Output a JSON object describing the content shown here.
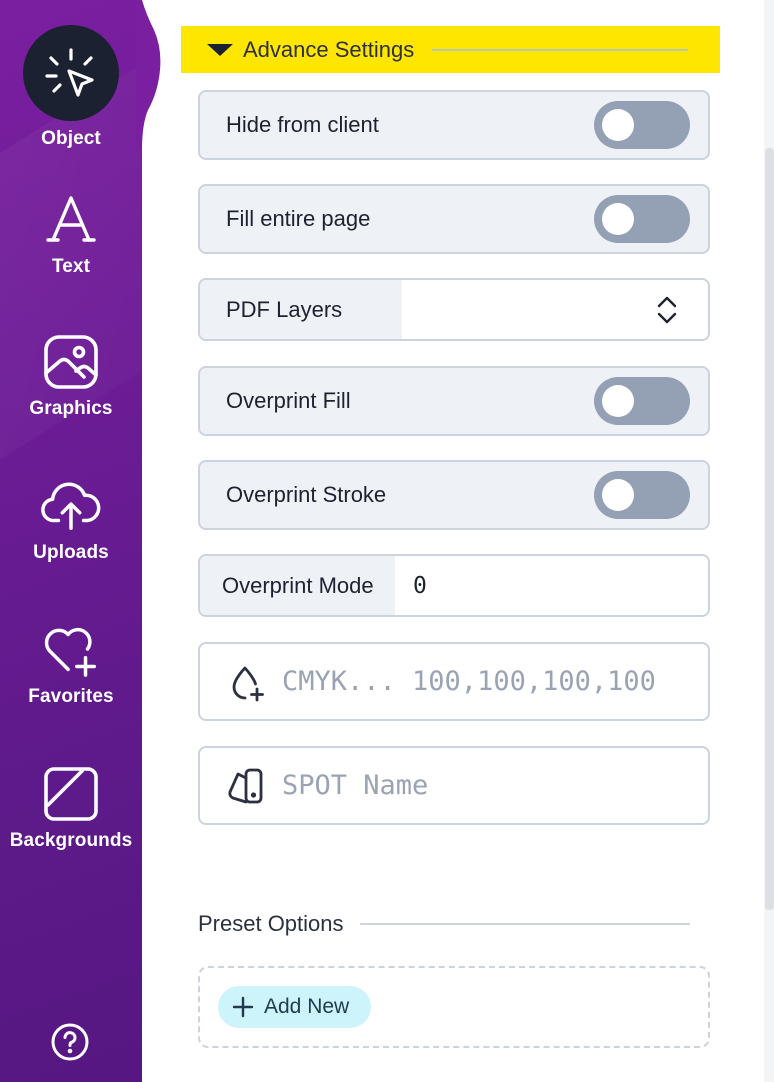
{
  "sidebar": {
    "items": [
      {
        "label": "Object",
        "icon": "cursor-click-icon",
        "active": true
      },
      {
        "label": "Text",
        "icon": "text-a-icon"
      },
      {
        "label": "Graphics",
        "icon": "image-icon"
      },
      {
        "label": "Uploads",
        "icon": "cloud-upload-icon"
      },
      {
        "label": "Favorites",
        "icon": "heart-plus-icon"
      },
      {
        "label": "Backgrounds",
        "icon": "background-icon"
      }
    ],
    "help_icon": "help-circle-icon"
  },
  "advance": {
    "title": "Advance Settings",
    "hide_from_client": "Hide from client",
    "fill_entire_page": "Fill entire page",
    "pdf_layers": "PDF Layers",
    "overprint_fill": "Overprint Fill",
    "overprint_stroke": "Overprint Stroke",
    "overprint_mode_label": "Overprint Mode",
    "overprint_mode_value": "0",
    "cmyk_placeholder": "CMYK... 100,100,100,100",
    "spot_placeholder": "SPOT Name"
  },
  "preset": {
    "title": "Preset Options",
    "add_new": "Add New"
  },
  "colors": {
    "sidebar": "#6d1c96",
    "accent_header": "#ffe600",
    "toggle_off": "#94a0b3",
    "add_button_bg": "#cdf4fa"
  }
}
